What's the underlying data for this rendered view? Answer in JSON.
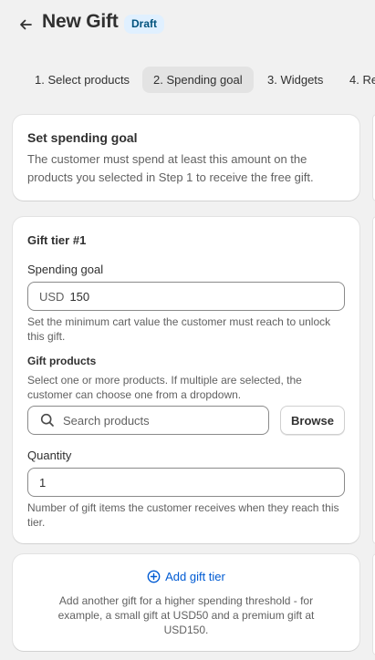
{
  "header": {
    "title": "New Gift",
    "badge": "Draft"
  },
  "tabs": [
    {
      "label": "1. Select products",
      "active": false
    },
    {
      "label": "2. Spending goal",
      "active": true
    },
    {
      "label": "3. Widgets",
      "active": false
    },
    {
      "label": "4. Re",
      "active": false
    }
  ],
  "intro_card": {
    "heading": "Set spending goal",
    "description": "The customer must spend at least this amount on the products you selected in Step 1 to receive the free gift."
  },
  "tier_card": {
    "heading": "Gift tier #1",
    "spending_goal": {
      "label": "Spending goal",
      "prefix": "USD",
      "value": "150",
      "help": "Set the minimum cart value the customer must reach to unlock this gift."
    },
    "gift_products": {
      "label": "Gift products",
      "help": "Select one or more products. If multiple are selected, the customer can choose one from a dropdown.",
      "search_placeholder": "Search products",
      "browse_label": "Browse"
    },
    "quantity": {
      "label": "Quantity",
      "value": "1",
      "help": "Number of gift items the customer receives when they reach this tier."
    }
  },
  "add_tier_card": {
    "link_label": "Add gift tier",
    "description": "Add another gift for a higher spending threshold - for example, a small gift at USD50 and a premium gift at USD150."
  },
  "colors": {
    "accent": "#005bd3",
    "badge_bg": "#e0f0ff",
    "background": "#f1f1f1"
  },
  "icons": {
    "back": "arrow-left-icon",
    "search": "search-icon",
    "add": "plus-circle-icon"
  }
}
